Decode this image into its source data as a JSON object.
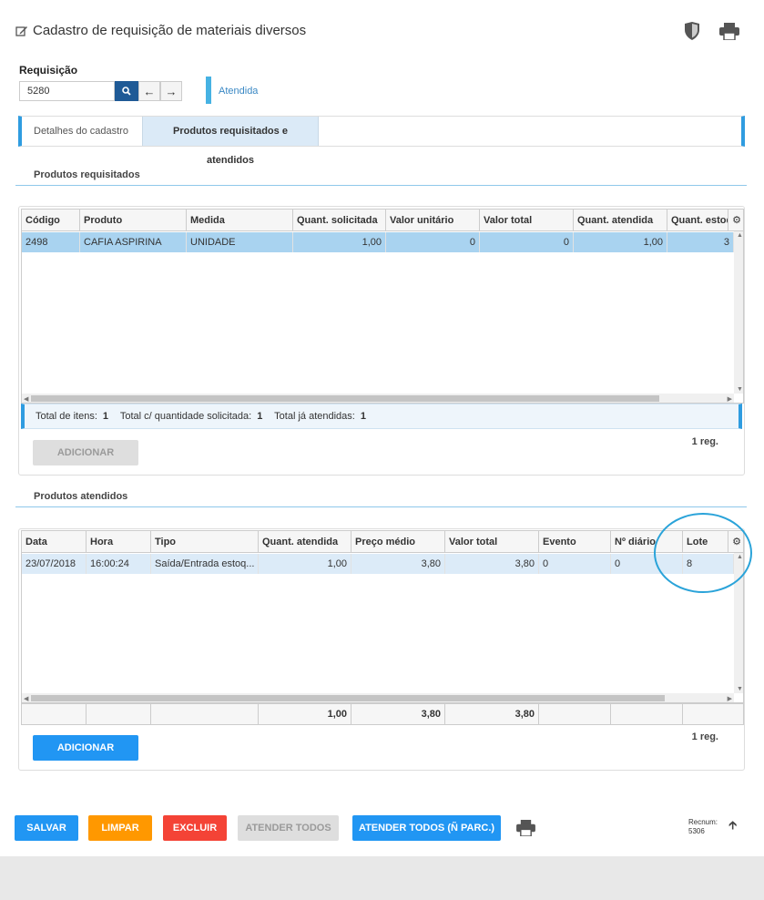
{
  "header": {
    "title": "Cadastro de requisição de materiais diversos"
  },
  "requisicao": {
    "label": "Requisição",
    "value": "5280",
    "status": "Atendida"
  },
  "tabs": [
    {
      "label": "Detalhes do cadastro"
    },
    {
      "label": "Produtos requisitados e atendidos"
    }
  ],
  "requisitados": {
    "title": "Produtos requisitados",
    "columns": [
      "Código",
      "Produto",
      "Medida",
      "Quant. solicitada",
      "Valor unitário",
      "Valor total",
      "Quant. atendida",
      "Quant. estoq"
    ],
    "rows": [
      [
        "2498",
        "CAFIA ASPIRINA",
        "UNIDADE",
        "1,00",
        "0",
        "0",
        "1,00",
        "3"
      ]
    ],
    "totals": {
      "itens_label": "Total de itens:",
      "itens_value": "1",
      "solicitada_label": "Total c/ quantidade solicitada:",
      "solicitada_value": "1",
      "atendidas_label": "Total já atendidas:",
      "atendidas_value": "1"
    },
    "add_label": "ADICIONAR",
    "reg": "1 reg."
  },
  "atendidos": {
    "title": "Produtos atendidos",
    "columns": [
      "Data",
      "Hora",
      "Tipo",
      "Quant. atendida",
      "Preço médio",
      "Valor total",
      "Evento",
      "Nº diário",
      "Lote"
    ],
    "rows": [
      [
        "23/07/2018",
        "16:00:24",
        "Saída/Entrada estoq...",
        "1,00",
        "3,80",
        "3,80",
        "0",
        "0",
        "8"
      ]
    ],
    "footer": [
      "",
      "",
      "",
      "1,00",
      "3,80",
      "3,80",
      "",
      "",
      ""
    ],
    "add_label": "ADICIONAR",
    "reg": "1 reg."
  },
  "actions": {
    "salvar": "SALVAR",
    "limpar": "LIMPAR",
    "excluir": "EXCLUIR",
    "atender_todos": "ATENDER TODOS",
    "atender_todos_nparc": "ATENDER TODOS (Ñ PARC.)"
  },
  "recnum": {
    "label": "Recnum:",
    "value": "5306"
  },
  "colors": {
    "primary_blue": "#2196f3",
    "dark_blue": "#1f5a96",
    "accent_blue": "#2f9ce0",
    "orange": "#ff9800",
    "red": "#f44336",
    "selected_row": "#a9d3f0",
    "selected_row_light": "#dcebf8"
  }
}
